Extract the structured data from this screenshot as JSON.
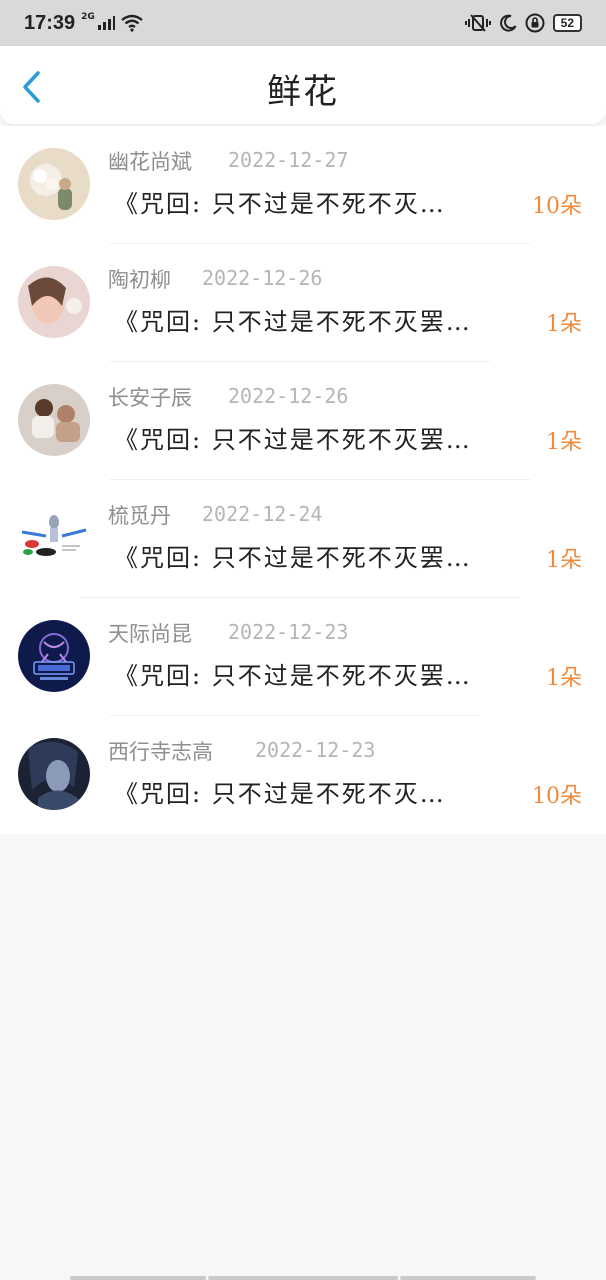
{
  "status": {
    "time": "17:39",
    "network": "2G",
    "battery": "52"
  },
  "header": {
    "title": "鲜花"
  },
  "colors": {
    "accent_blue": "#2a9ad8",
    "count_orange": "#f08a3c",
    "date_gray": "#b5b5b5"
  },
  "rows": [
    {
      "name": "幽花尚斌",
      "date": "2022-12-27",
      "message": "《咒回: 只不过是不死不灭…",
      "count": "10朵"
    },
    {
      "name": "陶初柳",
      "date": "2022-12-26",
      "message": "《咒回: 只不过是不死不灭罢…",
      "count": "1朵"
    },
    {
      "name": "长安子辰",
      "date": "2022-12-26",
      "message": "《咒回: 只不过是不死不灭罢…",
      "count": "1朵"
    },
    {
      "name": "梳觅丹",
      "date": "2022-12-24",
      "message": "《咒回: 只不过是不死不灭罢…",
      "count": "1朵"
    },
    {
      "name": "天际尚昆",
      "date": "2022-12-23",
      "message": "《咒回: 只不过是不死不灭罢…",
      "count": "1朵"
    },
    {
      "name": "西行寺志高",
      "date": "2022-12-23",
      "message": "《咒回: 只不过是不死不灭…",
      "count": "10朵"
    }
  ]
}
